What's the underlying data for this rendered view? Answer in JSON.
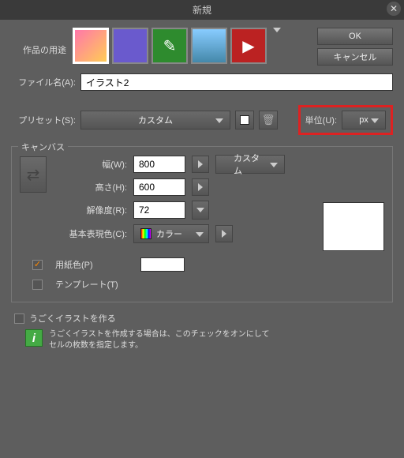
{
  "title": "新規",
  "buttons": {
    "ok": "OK",
    "cancel": "キャンセル"
  },
  "purpose_label": "作品の用途",
  "filename_label": "ファイル名(A):",
  "filename_value": "イラスト2",
  "preset_label": "プリセット(S):",
  "preset_value": "カスタム",
  "unit_label": "単位(U):",
  "unit_value": "px",
  "canvas": {
    "legend": "キャンバス",
    "width_label": "幅(W):",
    "width_value": "800",
    "height_label": "高さ(H):",
    "height_value": "600",
    "res_label": "解像度(R):",
    "res_value": "72",
    "colormode_label": "基本表現色(C):",
    "colormode_value": "カラー",
    "size_preset": "カスタム"
  },
  "paper_label": "用紙色(P)",
  "template_label": "テンプレート(T)",
  "paper_checked": true,
  "template_checked": false,
  "move_label": "うごくイラストを作る",
  "move_checked": false,
  "info_text_1": "うごくイラストを作成する場合は、このチェックをオンにして",
  "info_text_2": "セルの枚数を指定します。",
  "icons": {
    "t3": "✎",
    "t5": "▶"
  }
}
